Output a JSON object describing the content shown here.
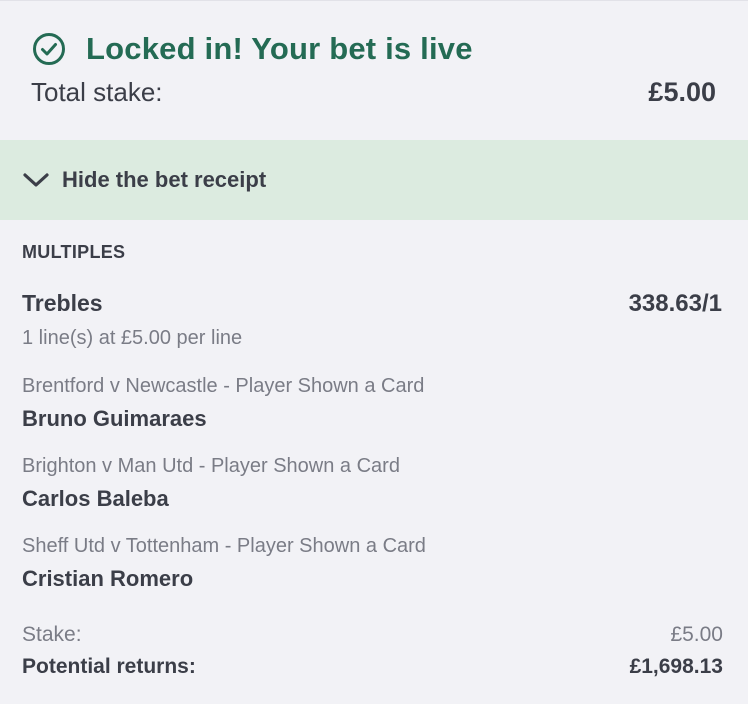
{
  "confirmation": {
    "title": "Locked in! Your bet is live",
    "icon": "check-circle-icon",
    "total_stake_label": "Total stake:",
    "total_stake_value": "£5.00"
  },
  "toggle": {
    "label": "Hide the bet receipt",
    "icon": "chevron-down-icon"
  },
  "receipt": {
    "section_title": "MULTIPLES",
    "bet_type": "Trebles",
    "odds": "338.63/1",
    "lines": "1 line(s) at £5.00 per line",
    "selections": [
      {
        "market": "Brentford v Newcastle - Player Shown a Card",
        "player": "Bruno Guimaraes"
      },
      {
        "market": "Brighton v Man Utd - Player Shown a Card",
        "player": "Carlos Baleba"
      },
      {
        "market": "Sheff Utd v Tottenham - Player Shown a Card",
        "player": "Cristian Romero"
      }
    ],
    "stake_label": "Stake:",
    "stake_value": "£5.00",
    "returns_label": "Potential returns:",
    "returns_value": "£1,698.13"
  },
  "colors": {
    "success_green": "#246b54",
    "toggle_bg": "#dcebe0",
    "page_bg": "#f2f2f6",
    "text_dark": "#3b3e48",
    "text_muted": "#7a7c86"
  }
}
